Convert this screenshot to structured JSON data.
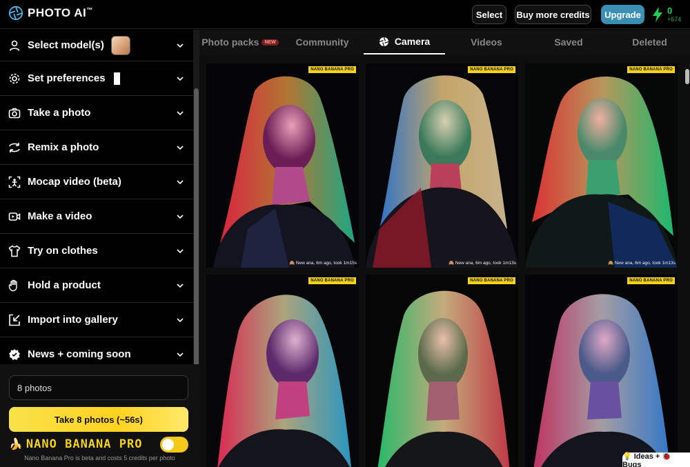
{
  "app": {
    "name": "PHOTO AI",
    "tm": "™"
  },
  "header": {
    "select_label": "Select",
    "buy_credits_label": "Buy more credits",
    "upgrade_label": "Upgrade",
    "credits": "0",
    "credits_delta": "+674",
    "colors": {
      "upgrade": "#3b8fb5",
      "credits": "#1fcf5a"
    }
  },
  "sidebar": {
    "items": [
      {
        "label": "Select model(s)",
        "icon": "user-icon"
      },
      {
        "label": "Set preferences",
        "icon": "gear-icon"
      },
      {
        "label": "Take a photo",
        "icon": "camera-icon"
      },
      {
        "label": "Remix a photo",
        "icon": "remix-icon"
      },
      {
        "label": "Mocap video (beta)",
        "icon": "mocap-icon"
      },
      {
        "label": "Make a video",
        "icon": "video-icon"
      },
      {
        "label": "Try on clothes",
        "icon": "shirt-icon"
      },
      {
        "label": "Hold a product",
        "icon": "hand-icon"
      },
      {
        "label": "Import into gallery",
        "icon": "import-icon"
      },
      {
        "label": "News + coming soon",
        "icon": "badge-icon"
      }
    ],
    "photo_count": "8 photos",
    "take_button": "Take 8 photos (~56s)",
    "model_name": "NANO BANANA PRO",
    "model_note": "Nano Banana Pro is beta and costs 5 credits per photo",
    "toggle_on": true,
    "colors": {
      "take_button": "#ffd21f",
      "model_name": "#f4d21a"
    }
  },
  "tabs": [
    {
      "label": "Photo packs",
      "badge": "NEW"
    },
    {
      "label": "Community"
    },
    {
      "label": "Camera",
      "active": true
    },
    {
      "label": "Videos"
    },
    {
      "label": "Saved"
    },
    {
      "label": "Deleted"
    }
  ],
  "photos": [
    {
      "badge": "NANO BANANA PRO",
      "caption": "🙈 New ana, 6m ago, took 1m15s"
    },
    {
      "badge": "NANO BANANA PRO",
      "caption": "🙈 New ana, 6m ago, took 1m13s"
    },
    {
      "badge": "NANO BANANA PRO",
      "caption": "🙈 New ana, 6m ago, took 1m13s"
    },
    {
      "badge": "NANO BANANA PRO",
      "caption": ""
    },
    {
      "badge": "NANO BANANA PRO",
      "caption": ""
    },
    {
      "badge": "NANO BANANA PRO",
      "caption": ""
    }
  ],
  "feedback": {
    "label": "💡 Ideas + 🐞 Bugs"
  }
}
